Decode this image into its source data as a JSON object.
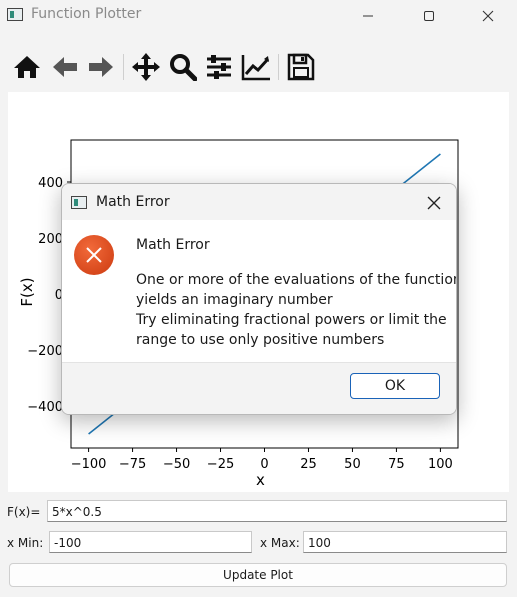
{
  "window": {
    "title": "Function Plotter",
    "minimize_glyph": "—",
    "maximize_glyph": "☐",
    "close_glyph": "✕"
  },
  "toolbar": {
    "icons": [
      "home-icon",
      "back-arrow-icon",
      "forward-arrow-icon",
      "pan-move-icon",
      "zoom-icon",
      "configure-subplots-icon",
      "edit-axis-icon",
      "save-icon"
    ]
  },
  "chart_data": {
    "type": "line",
    "xlabel": "x",
    "ylabel": "F(x)",
    "xlim": [
      -110,
      110
    ],
    "ylim": [
      -550,
      550
    ],
    "xticks": [
      -100,
      -75,
      -50,
      -25,
      0,
      25,
      50,
      75,
      100
    ],
    "xtick_labels": [
      "−100",
      "−75",
      "−50",
      "−25",
      "0",
      "25",
      "50",
      "75",
      "100"
    ],
    "yticks": [
      -400,
      -200,
      0,
      200,
      400
    ],
    "ytick_labels": [
      "−400",
      "−200",
      "0",
      "200",
      "400"
    ],
    "series": [
      {
        "x": [
          -100,
          100
        ],
        "y": [
          -500,
          500
        ],
        "color": "#1f77b4"
      }
    ],
    "grid": false
  },
  "form": {
    "fx_label": "F(x)=",
    "fx_value": "5*x^0.5",
    "xmin_label": "x Min:",
    "xmin_value": "-100",
    "xmax_label": "x Max:",
    "xmax_value": "100",
    "update_label": "Update Plot"
  },
  "dialog": {
    "title": "Math Error",
    "heading": "Math Error",
    "message_lines": [
      "One or more of the evaluations of the function",
      "yields an imaginary number",
      "Try eliminating fractional powers or limit the",
      "range to use only positive numbers"
    ],
    "ok_label": "OK",
    "close_glyph": "✕"
  },
  "colors": {
    "line": "#1f77b4",
    "error_icon": "#e0501e",
    "ok_border": "#1a63b8"
  }
}
